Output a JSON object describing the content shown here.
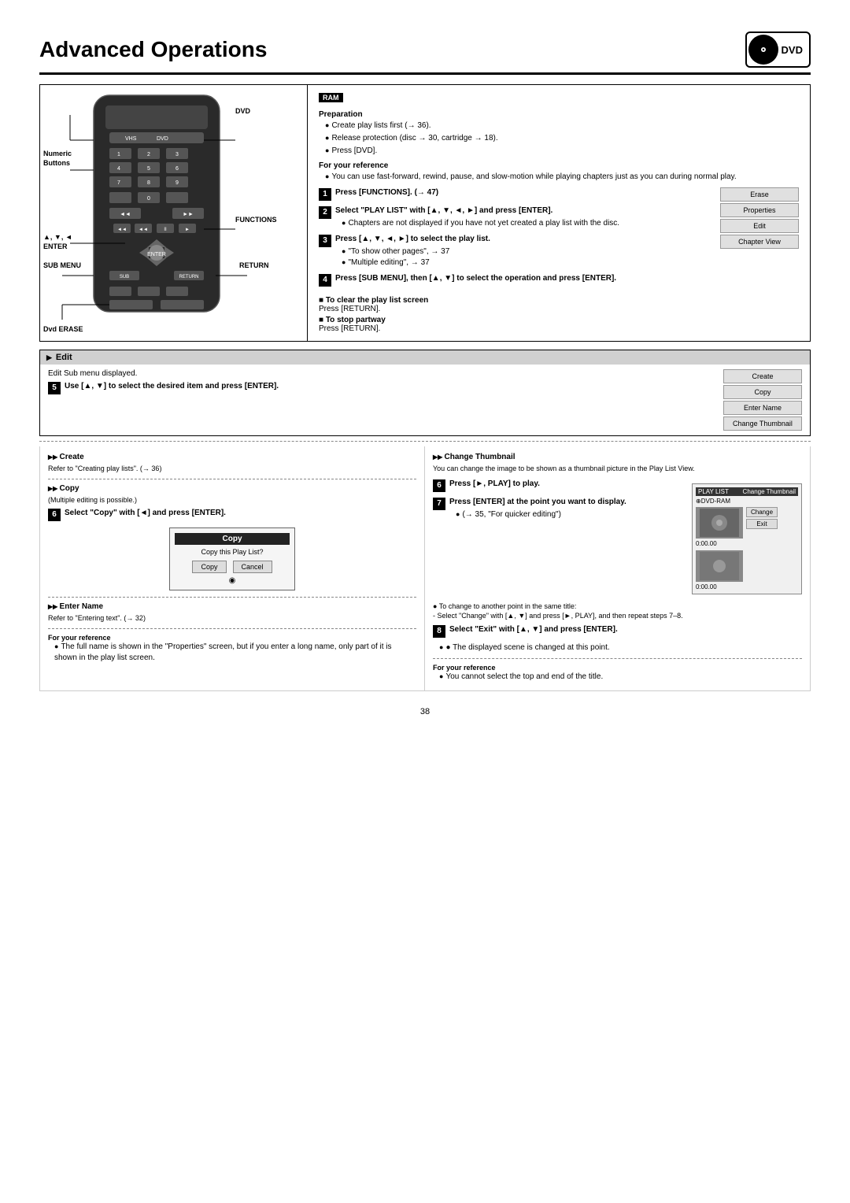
{
  "page": {
    "title": "Advanced Operations",
    "dvd_logo": "DVD",
    "page_number": "38"
  },
  "ram_section": {
    "badge": "RAM",
    "preparation_title": "Preparation",
    "preparation_bullets": [
      "Create play lists first (→ 36).",
      "Release protection (disc → 30, cartridge → 18).",
      "Press [DVD]."
    ],
    "for_reference_title": "For your reference",
    "for_reference_bullets": [
      "You can use fast-forward, rewind, pause, and slow-motion while playing chapters just as you can during normal play."
    ],
    "steps": [
      {
        "num": "1",
        "text": "Press [FUNCTIONS]. (→ 47)"
      },
      {
        "num": "2",
        "text": "Select \"PLAY LIST\" with [▲, ▼, ◄, ►] and press [ENTER].",
        "sub": [
          "Chapters are not displayed if you have not yet created a play list with the disc."
        ]
      },
      {
        "num": "3",
        "text": "Press [▲, ▼, ◄, ►] to select the play list.",
        "sub": [
          "\"To show other pages\", → 37",
          "\"Multiple editing\", → 37"
        ]
      },
      {
        "num": "4",
        "text": "Press [SUB MENU], then [▲, ▼] to select the operation and press [ENTER]."
      }
    ],
    "clear_title": "■ To clear the play list screen",
    "clear_text": "Press [RETURN].",
    "stop_title": "■ To stop partway",
    "stop_text": "Press [RETURN]."
  },
  "right_panel_buttons": [
    "Erase",
    "Properties",
    "Edit",
    "Chapter View"
  ],
  "edit_section": {
    "header": "Edit",
    "subtitle": "Edit Sub menu displayed.",
    "step5": {
      "num": "5",
      "text": "Use [▲, ▼] to select the desired item and press [ENTER]."
    },
    "panel_buttons2": [
      "Create",
      "Copy",
      "Enter Name",
      "Change Thumbnail"
    ]
  },
  "copy_subsection": {
    "title": "Copy",
    "note": "(Multiple editing is possible.)",
    "step6": {
      "num": "6",
      "text": "Select \"Copy\" with [◄] and press [ENTER]."
    },
    "dialog": {
      "title": "Copy",
      "body": "Copy this Play List?",
      "buttons": [
        "Copy",
        "Cancel"
      ]
    }
  },
  "enter_name_subsection": {
    "title": "Enter Name",
    "note": "Refer to \"Entering text\". (→ 32)",
    "for_ref_title": "For your reference",
    "for_ref_bullets": [
      "The full name is shown in the \"Properties\" screen, but if you enter a long name, only part of it is shown in the play list screen."
    ]
  },
  "change_thumbnail_subsection": {
    "title": "Change Thumbnail",
    "intro": "You can change the image to be shown as a thumbnail picture in the Play List View.",
    "step6": {
      "num": "6",
      "text": "Press [►, PLAY] to play."
    },
    "step7": {
      "num": "7",
      "text": "Press [ENTER] at the point you want to display.",
      "sub": [
        "(→ 35, \"For quicker editing\")"
      ]
    },
    "to_change_title": "● To change to another point in the same title:",
    "to_change_text": "- Select \"Change\" with [▲, ▼] and press [►, PLAY], and then repeat steps 7–8.",
    "step8": {
      "num": "8",
      "text": "Select \"Exit\" with [▲, ▼] and press [ENTER]."
    },
    "step8_sub": "● The displayed scene is changed at this point.",
    "for_ref_title": "For your reference",
    "for_ref_bullets": [
      "You cannot select the top and end of the title."
    ],
    "thumbnail_header_left": "PLAY LIST",
    "thumbnail_header_right": "Change Thumbnail",
    "thumbnail_source": "⊕DVD-RAM",
    "thumbnail_time1": "0:00.00",
    "thumbnail_time2": "0:00.00",
    "thumbnail_btn_change": "Change",
    "thumbnail_btn_exit": "Exit"
  },
  "create_subsection": {
    "title": "Create",
    "note": "Refer to \"Creating play lists\". (→ 36)"
  },
  "remote_labels": {
    "numeric": "Numeric\nButtons",
    "dvd": "DVD",
    "functions": "FUNCTIONS",
    "enter_arrows": "▲, ▼, ◄\nENTER",
    "submenu": "SUB MENU",
    "return": "RETURN",
    "erase": "Dvd ERASE"
  }
}
